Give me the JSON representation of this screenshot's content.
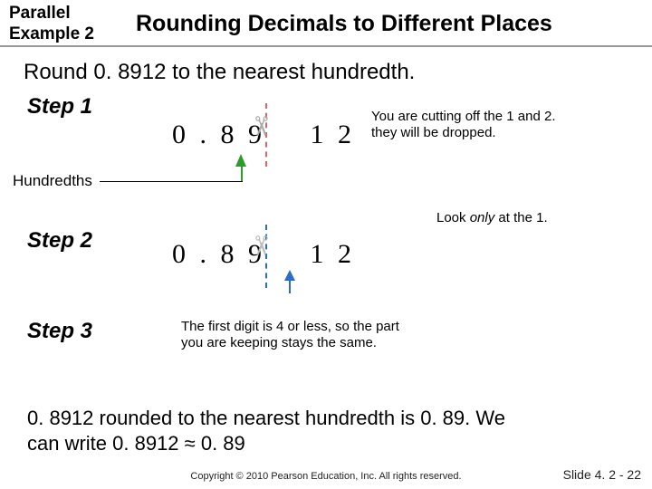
{
  "header": {
    "parallel_line1": "Parallel",
    "parallel_line2": "Example 2",
    "title": "Rounding Decimals to Different Places"
  },
  "instruction": "Round 0. 8912 to the nearest hundredth.",
  "step1": {
    "label": "Step 1",
    "num_left": "0 . 8 9",
    "num_right": "1 2",
    "note_a": "You are cutting off the 1 and 2.",
    "note_b": "they will be dropped.",
    "hundredths": "Hundredths"
  },
  "step2": {
    "label": "Step 2",
    "look_prefix": "Look ",
    "look_only": "only",
    "look_suffix": " at the 1.",
    "num_left": "0 . 8 9",
    "num_right": "1 2"
  },
  "step3": {
    "label": "Step 3",
    "note_a": "The first digit is 4 or less, so the part",
    "note_b": "you are keeping stays the same."
  },
  "conclusion_a": "0. 8912 rounded to the nearest hundredth is 0. 89. We",
  "conclusion_b": "can write 0. 8912 ≈ 0. 89",
  "footer": {
    "copyright": "Copyright © 2010 Pearson Education, Inc.  All rights reserved.",
    "slide": "Slide 4. 2 - 22"
  }
}
